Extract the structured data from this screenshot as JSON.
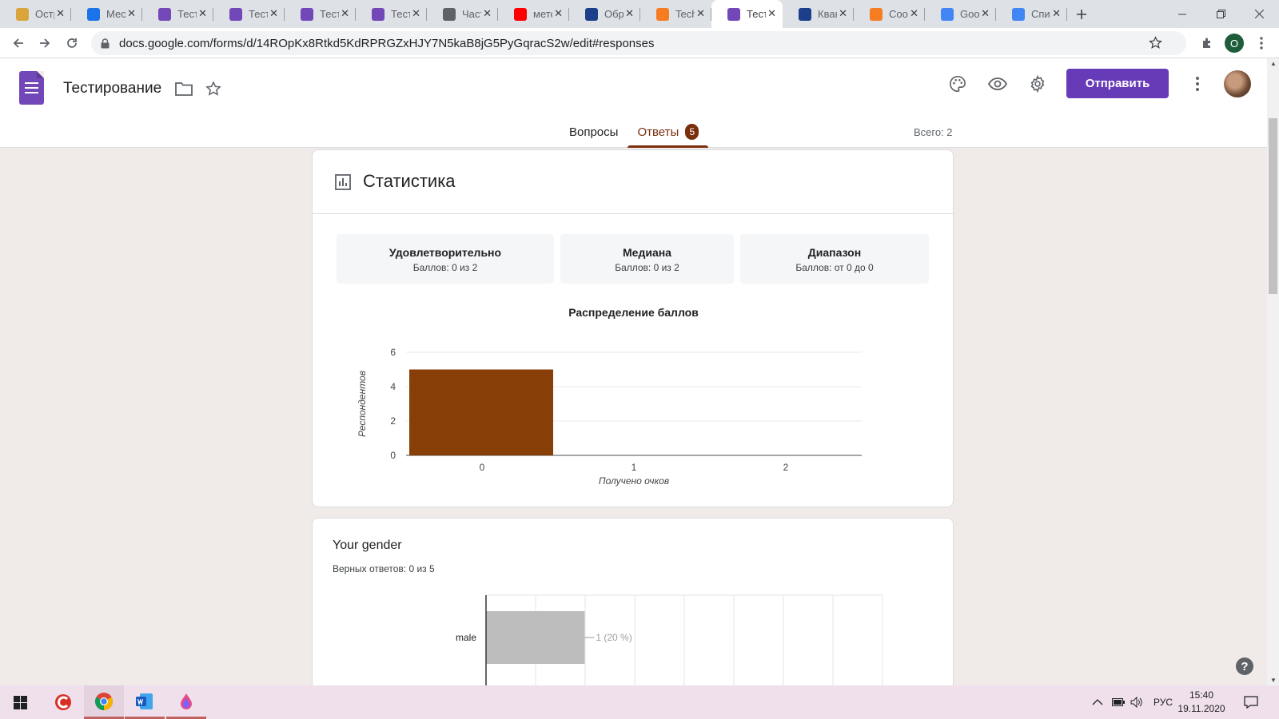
{
  "browser": {
    "tabs": [
      {
        "title": "Остров",
        "favicon_color": "#d9a43a",
        "favicon": "folder-chat-icon"
      },
      {
        "title": "Мессенджер",
        "favicon_color": "#1a73e8",
        "favicon": "chat-icon"
      },
      {
        "title": "Тест",
        "favicon_color": "#7248b9",
        "favicon": "forms-icon"
      },
      {
        "title": "Тест",
        "favicon_color": "#7248b9",
        "favicon": "forms-icon"
      },
      {
        "title": "Тест",
        "favicon_color": "#7248b9",
        "favicon": "forms-icon"
      },
      {
        "title": "Тест",
        "favicon_color": "#7248b9",
        "favicon": "forms-icon"
      },
      {
        "title": "Часть",
        "favicon_color": "#5f6368",
        "favicon": "globe-icon"
      },
      {
        "title": "метод",
        "favicon_color": "#ff0000",
        "favicon": "yandex-icon"
      },
      {
        "title": "Обр",
        "favicon_color": "#1d3e8a",
        "favicon": "feather-icon"
      },
      {
        "title": "Tech",
        "favicon_color": "#f57c20",
        "favicon": "blogger-icon"
      },
      {
        "title": "Тест",
        "favicon_color": "#7248b9",
        "favicon": "forms-icon",
        "active": true
      },
      {
        "title": "Квант",
        "favicon_color": "#1d3e8a",
        "favicon": "feather-icon"
      },
      {
        "title": "Coo",
        "favicon_color": "#f57c20",
        "favicon": "blogger-icon"
      },
      {
        "title": "Goo",
        "favicon_color": "#4285f4",
        "favicon": "translate-icon"
      },
      {
        "title": "Спи",
        "favicon_color": "#4285f4",
        "favicon": "google-icon"
      }
    ],
    "url": "docs.google.com/forms/d/14ROpKx8Rtkd5KdRPRGZxHJY7N5kaB8jG5PyGqracS2w/edit#responses",
    "profile_initial": "O"
  },
  "form": {
    "title": "Тестирование",
    "send_label": "Отправить",
    "tabs": [
      {
        "label": "Вопросы",
        "active": false
      },
      {
        "label": "Ответы",
        "active": true,
        "badge": "5"
      }
    ],
    "total": "Всего: 2"
  },
  "stats": {
    "title": "Статистика",
    "boxes": [
      {
        "title": "Удовлетворительно",
        "value": "Баллов: 0 из 2"
      },
      {
        "title": "Медиана",
        "value": "Баллов: 0 из 2"
      },
      {
        "title": "Диапазон",
        "value": "Баллов: от 0 до 0"
      }
    ]
  },
  "chart_data": [
    {
      "type": "bar",
      "title": "Распределение баллов",
      "categories": [
        "0",
        "1",
        "2"
      ],
      "values": [
        5,
        0,
        0
      ],
      "xlabel": "Получено очков",
      "ylabel": "Респондентов",
      "ylim": [
        0,
        6
      ],
      "yticks": [
        "0",
        "2",
        "4",
        "6"
      ],
      "grid": true,
      "color": "#873e07"
    },
    {
      "type": "bar",
      "orientation": "horizontal",
      "categories": [
        "male"
      ],
      "values": [
        1
      ],
      "data_labels": [
        "1 (20 %)"
      ],
      "xlim": [
        0,
        4
      ],
      "grid": true,
      "color": "#bdbdbd"
    }
  ],
  "question": {
    "title": "Your gender",
    "subtitle": "Верных ответов: 0 из 5"
  },
  "help_label": "?",
  "taskbar": {
    "apps": [
      "windows-start-icon",
      "ccleaner-icon",
      "chrome-icon",
      "word-icon",
      "paint-icon"
    ],
    "language": "РУС",
    "time": "15:40",
    "date": "19.11.2020"
  }
}
